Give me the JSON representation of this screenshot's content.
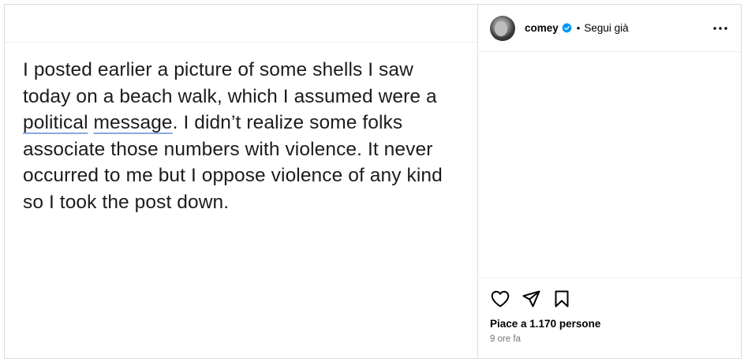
{
  "post": {
    "image_text": {
      "segments": [
        {
          "text": "I posted earlier a picture of some shells I saw today on a beach walk, which I assumed were a ",
          "underline": false
        },
        {
          "text": "political",
          "underline": true
        },
        {
          "text": " ",
          "underline": false
        },
        {
          "text": "message",
          "underline": true
        },
        {
          "text": ". I didn’t realize some folks associate those numbers with violence. It never occurred to me but I oppose violence of any kind so I took the post down.",
          "underline": false
        }
      ]
    }
  },
  "header": {
    "username": "comey",
    "verified": true,
    "separator": "•",
    "follow_label": "Segui già",
    "more_icon": "more-horizontal-icon"
  },
  "footer": {
    "likes_text": "Piace a 1.170 persone",
    "time_text": "9 ore fa",
    "icons": [
      "heart-icon",
      "share-icon",
      "bookmark-icon"
    ]
  },
  "colors": {
    "verified_badge": "#0095f6",
    "secondary_text": "#737373",
    "border": "#dbdbdb",
    "underline": "#8aa8e0"
  }
}
